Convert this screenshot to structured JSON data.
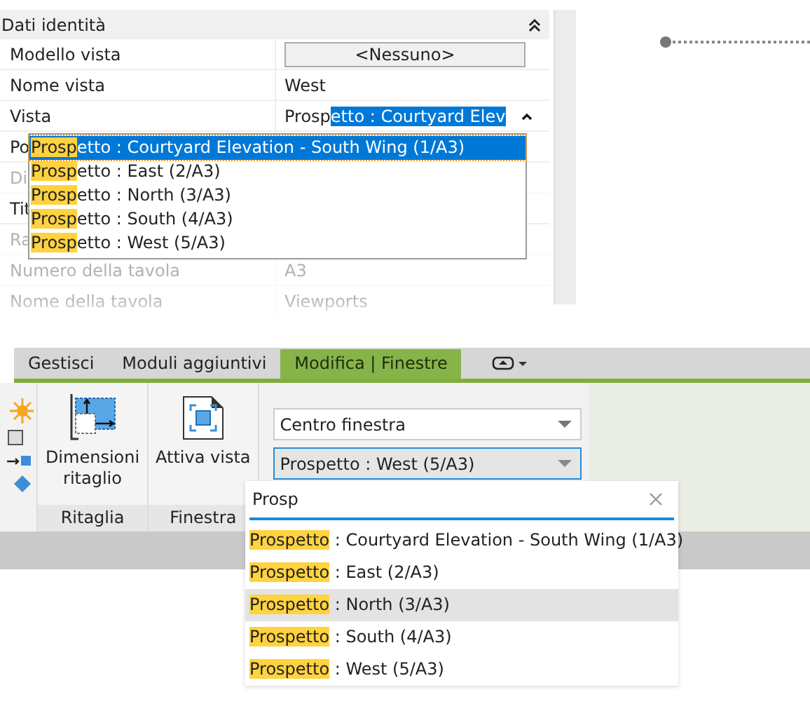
{
  "properties": {
    "section": {
      "title": "Dati identità",
      "expanded": true
    },
    "rows": [
      {
        "kind": "button",
        "label": "Modello vista",
        "value": "<Nessuno>"
      },
      {
        "kind": "text",
        "label": "Nome vista",
        "value": "West"
      },
      {
        "kind": "combo",
        "label": "Vista",
        "value": "Prosp",
        "value_selected": "etto : Courtyard Elev"
      },
      {
        "kind": "hidden",
        "label": "Po",
        "faded": false
      },
      {
        "kind": "hidden",
        "label": "Di",
        "faded": true
      },
      {
        "kind": "hidden",
        "label": "Tit",
        "faded": false
      },
      {
        "kind": "hidden",
        "label": "Ra",
        "faded": true
      },
      {
        "kind": "text",
        "label": "Numero della tavola",
        "value": "A3",
        "faded": true
      },
      {
        "kind": "text",
        "label": "Nome della tavola",
        "value": "Viewports",
        "faded": true
      }
    ],
    "dropdown": [
      {
        "match": "Prosp",
        "rest": "etto : Courtyard Elevation - South Wing (1/A3)",
        "selected": true
      },
      {
        "match": "Prosp",
        "rest": "etto : East (2/A3)",
        "selected": false
      },
      {
        "match": "Prosp",
        "rest": "etto : North (3/A3)",
        "selected": false
      },
      {
        "match": "Prosp",
        "rest": "etto : South (4/A3)",
        "selected": false
      },
      {
        "match": "Prosp",
        "rest": "etto : West (5/A3)",
        "selected": false
      }
    ]
  },
  "ribbon": {
    "tabs": [
      {
        "label": "Gestisci",
        "selected": false
      },
      {
        "label": "Moduli aggiuntivi",
        "selected": false
      },
      {
        "label": "Modifica | Finestre",
        "selected": true
      }
    ],
    "panels": [
      {
        "title": "Ritaglia",
        "buttons": [
          {
            "label": "Dimensioni ritaglio"
          }
        ]
      },
      {
        "title": "Finestra",
        "buttons": [
          {
            "label": "Attiva vista"
          }
        ]
      }
    ],
    "combo_1": {
      "value": "Centro finestra"
    },
    "combo_2": {
      "value": "Prospetto : West (5/A3)"
    },
    "search": {
      "value": "Prosp"
    },
    "results": [
      {
        "match": "Prospetto",
        "rest": " : Courtyard Elevation - South Wing (1/A3)",
        "selected": false
      },
      {
        "match": "Prospetto",
        "rest": " : East (2/A3)",
        "selected": false
      },
      {
        "match": "Prospetto",
        "rest": " : North (3/A3)",
        "selected": true
      },
      {
        "match": "Prospetto",
        "rest": " : South (4/A3)",
        "selected": false
      },
      {
        "match": "Prospetto",
        "rest": " : West (5/A3)",
        "selected": false
      }
    ]
  }
}
